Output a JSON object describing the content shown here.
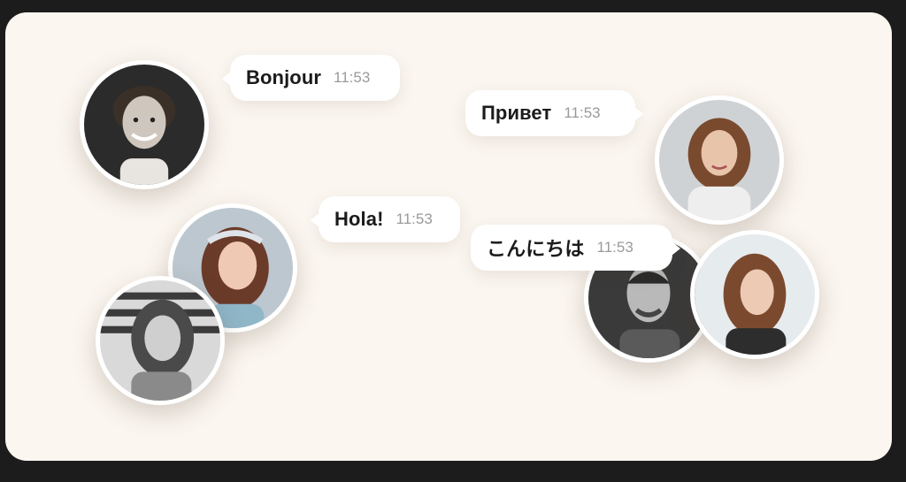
{
  "messages": [
    {
      "text": "Bonjour",
      "time": "11:53"
    },
    {
      "text": "Привет",
      "time": "11:53"
    },
    {
      "text": "Hola!",
      "time": "11:53"
    },
    {
      "text": "こんにちは",
      "time": "11:53"
    }
  ]
}
